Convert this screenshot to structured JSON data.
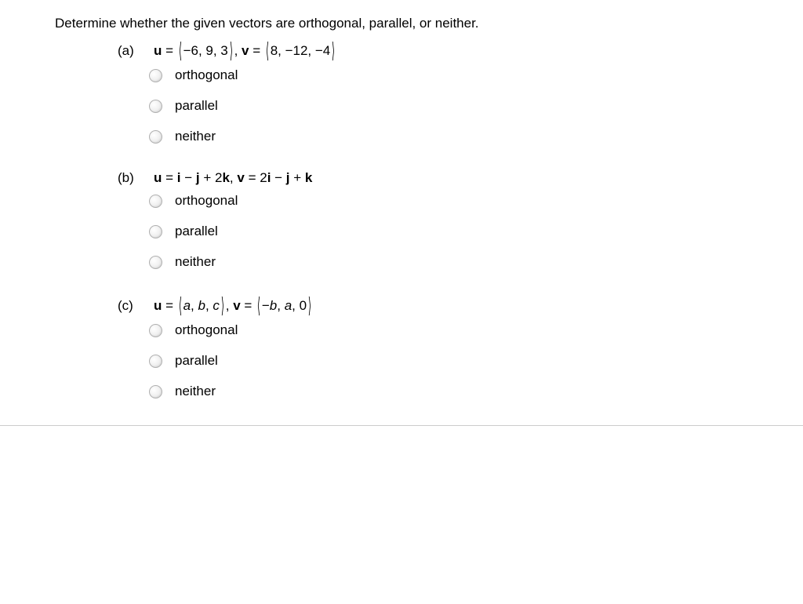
{
  "prompt": "Determine whether the given vectors are orthogonal, parallel, or neither.",
  "questions": {
    "a": {
      "label": "(a)",
      "u_prefix": "u",
      "eq": " = ",
      "u_open": "⟨",
      "u_vals": "−6, 9, 3",
      "u_close": "⟩",
      "sep": ",    ",
      "v_prefix": "v",
      "v_open": "⟨",
      "v_vals": "8, −12, −4",
      "v_close": "⟩"
    },
    "b": {
      "label": "(b)",
      "u_prefix": "u",
      "eq": " = ",
      "u_expr_parts": [
        "i",
        " − ",
        "j",
        " + 2",
        "k"
      ],
      "sep": ",    ",
      "v_prefix": "v",
      "v_expr_parts": [
        " = 2",
        "i",
        " − ",
        "j",
        " + ",
        "k"
      ]
    },
    "c": {
      "label": "(c)",
      "u_prefix": "u",
      "eq": " = ",
      "u_open": "⟨",
      "u_vals_parts": [
        "a",
        ", ",
        "b",
        ", ",
        "c"
      ],
      "u_close": "⟩",
      "sep": ",    ",
      "v_prefix": "v",
      "v_open": "⟨",
      "v_vals_parts": [
        "−",
        "b",
        ", ",
        "a",
        ", 0"
      ],
      "v_close": "⟩"
    }
  },
  "options": {
    "orthogonal": "orthogonal",
    "parallel": "parallel",
    "neither": "neither"
  }
}
